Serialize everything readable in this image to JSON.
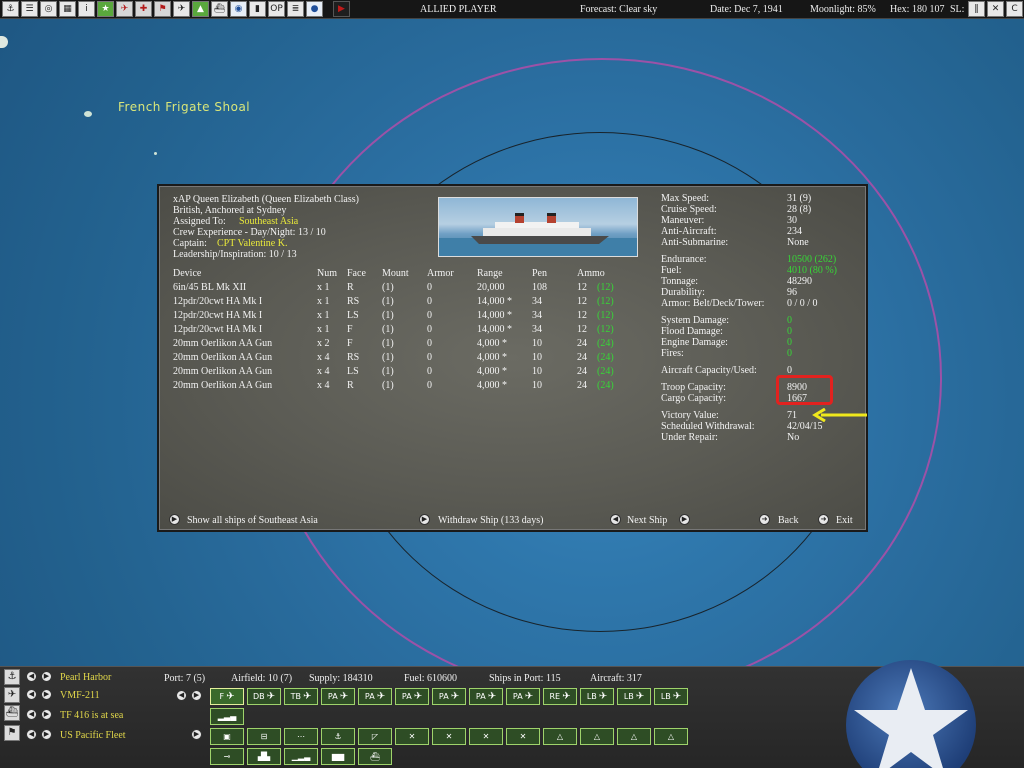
{
  "topbar": {
    "buttons": [
      "anchor-icon",
      "list-icon",
      "target-icon",
      "grid-icon",
      "info-icon",
      "star-icon",
      "plane-red-icon",
      "plane-red-2-icon",
      "flag-icon",
      "plane-icon",
      "chart-icon",
      "ship-icon",
      "globe-icon",
      "bars-icon",
      "op-icon",
      "list-2-icon",
      "circle-icon",
      "play-icon"
    ],
    "op_label": "OP",
    "player": "ALLIED PLAYER",
    "forecast": "Forecast: Clear sky",
    "date": "Date: Dec 7, 1941",
    "moonlight": "Moonlight: 85%",
    "hex": "Hex: 180 107",
    "sl": "SL:"
  },
  "map": {
    "label": "French Frigate Shoal"
  },
  "ship": {
    "name": "xAP Queen Elizabeth (Queen Elizabeth Class)",
    "status": "British, Anchored at Sydney",
    "assigned_label": "Assigned To:",
    "assigned_value": "Southeast Asia",
    "crew_exp": "Crew Experience - Day/Night: 13 / 10",
    "captain_label": "Captain:",
    "captain_value": "CPT Valentine K.",
    "leadership": "Leadership/Inspiration: 10 / 13",
    "weapons_headers": [
      "Device",
      "Num",
      "Face",
      "Mount",
      "Armor",
      "Range",
      "Pen",
      "Ammo"
    ],
    "weapons": [
      {
        "device": "6in/45 BL Mk XII",
        "num": "x 1",
        "face": "R",
        "mount": "(1)",
        "armor": "0",
        "range": "20,000",
        "pen": "108",
        "ammo": "12",
        "ammo_extra": "(12)"
      },
      {
        "device": "12pdr/20cwt HA Mk I",
        "num": "x 1",
        "face": "RS",
        "mount": "(1)",
        "armor": "0",
        "range": "14,000 *",
        "pen": "34",
        "ammo": "12",
        "ammo_extra": "(12)"
      },
      {
        "device": "12pdr/20cwt HA Mk I",
        "num": "x 1",
        "face": "LS",
        "mount": "(1)",
        "armor": "0",
        "range": "14,000 *",
        "pen": "34",
        "ammo": "12",
        "ammo_extra": "(12)"
      },
      {
        "device": "12pdr/20cwt HA Mk I",
        "num": "x 1",
        "face": "F",
        "mount": "(1)",
        "armor": "0",
        "range": "14,000 *",
        "pen": "34",
        "ammo": "12",
        "ammo_extra": "(12)"
      },
      {
        "device": "20mm Oerlikon AA Gun",
        "num": "x 2",
        "face": "F",
        "mount": "(1)",
        "armor": "0",
        "range": "4,000 *",
        "pen": "10",
        "ammo": "24",
        "ammo_extra": "(24)"
      },
      {
        "device": "20mm Oerlikon AA Gun",
        "num": "x 4",
        "face": "RS",
        "mount": "(1)",
        "armor": "0",
        "range": "4,000 *",
        "pen": "10",
        "ammo": "24",
        "ammo_extra": "(24)"
      },
      {
        "device": "20mm Oerlikon AA Gun",
        "num": "x 4",
        "face": "LS",
        "mount": "(1)",
        "armor": "0",
        "range": "4,000 *",
        "pen": "10",
        "ammo": "24",
        "ammo_extra": "(24)"
      },
      {
        "device": "20mm Oerlikon AA Gun",
        "num": "x 4",
        "face": "R",
        "mount": "(1)",
        "armor": "0",
        "range": "4,000 *",
        "pen": "10",
        "ammo": "24",
        "ammo_extra": "(24)"
      }
    ],
    "stats": [
      {
        "label": "Max Speed:",
        "value": "31 (9)",
        "color": "white"
      },
      {
        "label": "Cruise Speed:",
        "value": "28 (8)",
        "color": "white"
      },
      {
        "label": "Maneuver:",
        "value": "30",
        "color": "white"
      },
      {
        "label": "Anti-Aircraft:",
        "value": "234",
        "color": "white"
      },
      {
        "label": "Anti-Submarine:",
        "value": "None",
        "color": "white"
      },
      {
        "label": "Endurance:",
        "value": "10500 (262)",
        "color": "green"
      },
      {
        "label": "Fuel:",
        "value": "4010 (80 %)",
        "color": "green"
      },
      {
        "label": "Tonnage:",
        "value": "48290",
        "color": "white"
      },
      {
        "label": "Durability:",
        "value": "96",
        "color": "white"
      },
      {
        "label": "Armor: Belt/Deck/Tower:",
        "value": "0 / 0 / 0",
        "color": "white"
      },
      {
        "label": "System Damage:",
        "value": "0",
        "color": "green"
      },
      {
        "label": "Flood Damage:",
        "value": "0",
        "color": "green"
      },
      {
        "label": "Engine Damage:",
        "value": "0",
        "color": "green"
      },
      {
        "label": "Fires:",
        "value": "0",
        "color": "green"
      },
      {
        "label": "Aircraft Capacity/Used:",
        "value": "0",
        "color": "white"
      },
      {
        "label": "Troop Capacity:",
        "value": "8900",
        "color": "white"
      },
      {
        "label": "Cargo Capacity:",
        "value": "1667",
        "color": "white"
      },
      {
        "label": "Victory Value:",
        "value": "71",
        "color": "white"
      },
      {
        "label": "Scheduled Withdrawal:",
        "value": "42/04/15",
        "color": "white"
      },
      {
        "label": "Under Repair:",
        "value": "No",
        "color": "white"
      }
    ],
    "actions": {
      "show_all": "Show all ships of Southeast Asia",
      "withdraw": "Withdraw Ship (133 days)",
      "next": "Next Ship",
      "back": "Back",
      "exit": "Exit"
    },
    "highlight_color": "#e2221f",
    "arrow_color": "#f0e81c"
  },
  "bottombar": {
    "rows": [
      {
        "icon": "anchor-icon",
        "label": "Pearl Harbor"
      },
      {
        "icon": "plane-icon",
        "label": "VMF-211"
      },
      {
        "icon": "ship-icon",
        "label": "TF 416 is at sea"
      },
      {
        "icon": "flag-icon",
        "label": "US Pacific Fleet"
      }
    ],
    "stats": {
      "port": "Port: 7 (5)",
      "airfield": "Airfield: 10 (7)",
      "supply": "Supply: 184310",
      "fuel": "Fuel: 610600",
      "ships": "Ships in Port: 115",
      "aircraft": "Aircraft: 317"
    },
    "air_slots": [
      "F",
      "DB",
      "TB",
      "PA",
      "PA",
      "PA",
      "PA",
      "PA",
      "PA",
      "RE",
      "LB",
      "LB",
      "LB"
    ],
    "accent": "#e2d84a"
  }
}
